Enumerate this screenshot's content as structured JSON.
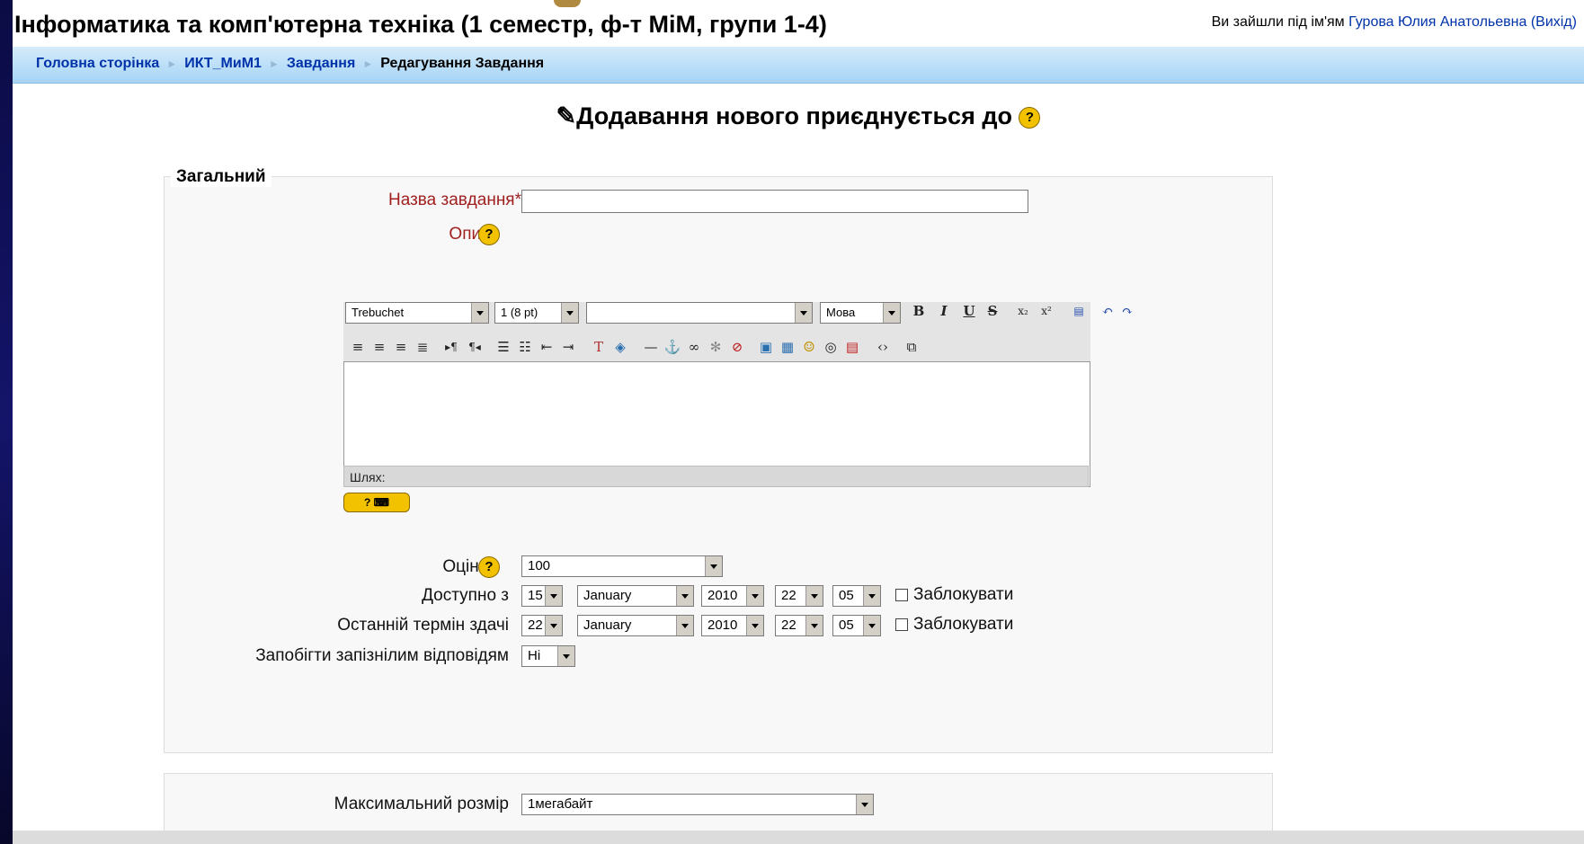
{
  "header": {
    "title": "Інформатика та комп'ютерна техніка (1 семестр, ф-т МіМ, групи 1-4)",
    "login_prefix": "Ви зайшли під ім'ям",
    "user_name": "Гурова Юлия Анатольевна",
    "logout": "(Вихід)"
  },
  "breadcrumb": {
    "home": "Головна сторінка",
    "course": "ИКТ_МиМ1",
    "section": "Завдання",
    "current": "Редагування Завдання",
    "separator": "►"
  },
  "page_heading": "Додавання нового приєднується до",
  "form": {
    "legend": "Загальний",
    "name_label": "Назва завдання*",
    "name_value": "",
    "description_label": "Опис*",
    "editor": {
      "font": "Trebuchet",
      "size": "1 (8 pt)",
      "format": "",
      "language": "Мова",
      "path_label": "Шлях:",
      "help_button": "?"
    },
    "grade_label": "Оцінка",
    "grade_value": "100",
    "available_label": "Доступно з",
    "available": {
      "day": "15",
      "month": "January",
      "year": "2010",
      "hour": "22",
      "minute": "05",
      "lock_label": "Заблокувати"
    },
    "due_label": "Останній термін здачі",
    "due": {
      "day": "22",
      "month": "January",
      "year": "2010",
      "hour": "22",
      "minute": "05",
      "lock_label": "Заблокувати"
    },
    "prevent_late_label": "Запобігти запізнілим відповідям",
    "prevent_late_value": "Ні",
    "max_size_label": "Максимальний розмір",
    "max_size_value": "1мегабайт"
  },
  "icons": {
    "help": "question-icon",
    "edit": "pencil-icon"
  }
}
